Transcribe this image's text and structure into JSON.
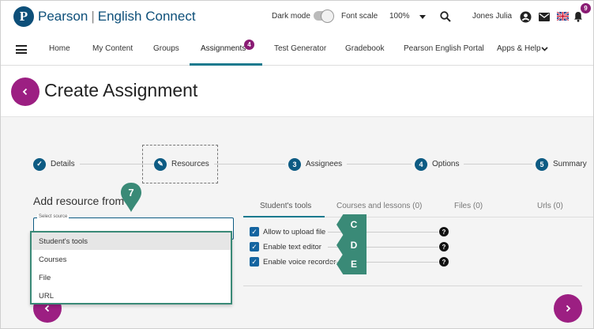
{
  "topbar": {
    "logo_letter": "P",
    "brand_name": "Pearson",
    "brand_product": "English Connect",
    "dark_mode_label": "Dark mode",
    "font_scale_label": "Font scale",
    "zoom_value": "100%",
    "user_name": "Jones Julia",
    "notifications_count": "9"
  },
  "nav": {
    "items": [
      {
        "label": "Home"
      },
      {
        "label": "My Content"
      },
      {
        "label": "Groups"
      },
      {
        "label": "Assignments"
      },
      {
        "label": "Test Generator"
      },
      {
        "label": "Gradebook"
      },
      {
        "label": "Pearson English Portal"
      },
      {
        "label": "Apps & Help"
      }
    ],
    "assignments_badge": "4"
  },
  "header": {
    "title": "Create Assignment"
  },
  "steps": [
    {
      "number": "✓",
      "label": "Details"
    },
    {
      "number": "✎",
      "label": "Resources"
    },
    {
      "number": "3",
      "label": "Assignees"
    },
    {
      "number": "4",
      "label": "Options"
    },
    {
      "number": "5",
      "label": "Summary"
    }
  ],
  "resource": {
    "heading": "Add resource from",
    "select_legend": "Select source",
    "options": [
      "Student's tools",
      "Courses",
      "File",
      "URL"
    ]
  },
  "tabs": [
    {
      "label": "Student's tools"
    },
    {
      "label": "Courses and lessons (0)"
    },
    {
      "label": "Files (0)"
    },
    {
      "label": "Urls (0)"
    }
  ],
  "tool_options": [
    {
      "label": "Allow to upload file",
      "checked": true
    },
    {
      "label": "Enable text editor",
      "checked": true
    },
    {
      "label": "Enable voice recorder",
      "checked": true
    }
  ],
  "callouts": {
    "seven": "7",
    "c": "C",
    "d": "D",
    "e": "E"
  },
  "colors": {
    "brand": "#0d4f79",
    "accent": "#9c1f82",
    "teal": "#1a7a8e",
    "callout": "#3a8a77"
  }
}
